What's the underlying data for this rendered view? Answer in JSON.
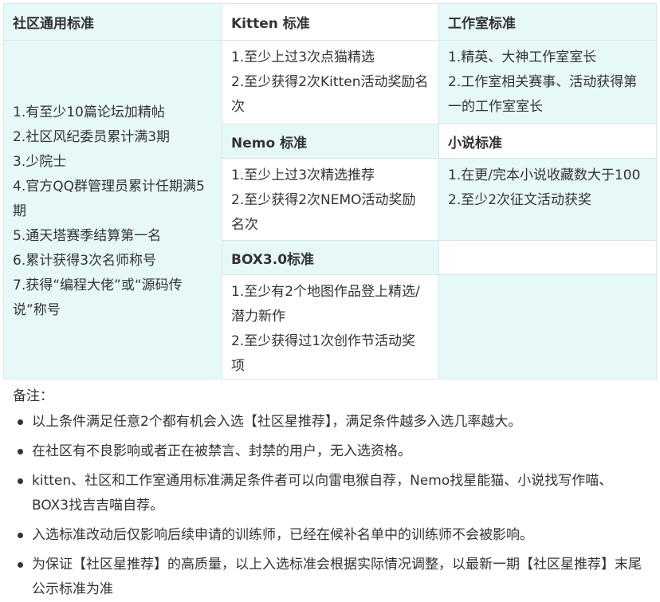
{
  "table": {
    "columns": [
      {
        "header": "社区通用标准",
        "items": [
          "1.有至少10篇论坛加精帖",
          "2.社区风纪委员累计满3期",
          "3.少院士",
          "4.官方QQ群管理员累计任期满5期",
          "5.通天塔赛季结算第一名",
          "6.累计获得3次名师称号",
          "7.获得“编程大佬”或“源码传说”称号"
        ]
      },
      {
        "sections": [
          {
            "header": "Kitten 标准",
            "items": [
              "1.至少上过3次点猫精选",
              "2.至少获得2次Kitten活动奖励名次"
            ]
          },
          {
            "header": "Nemo 标准",
            "items": [
              "1.至少上过3次精选推荐",
              "2.至少获得2次NEMO活动奖励名次"
            ]
          },
          {
            "header": "BOX3.0标准",
            "items": [
              "1.至少有2个地图作品登上精选/潜力新作",
              "2.至少获得过1次创作节活动奖项"
            ]
          }
        ]
      },
      {
        "sections": [
          {
            "header": "工作室标准",
            "items": [
              "1.精英、大神工作室室长",
              "2.工作室相关赛事、活动获得第一的工作室室长"
            ]
          },
          {
            "header": "小说标准",
            "items": [
              "1.在更/完本小说收藏数大于100",
              "2.至少2次征文活动获奖"
            ]
          }
        ]
      }
    ]
  },
  "notes": {
    "label": "备注：",
    "bullets": [
      "以上条件满足任意2个都有机会入选【社区星推荐】，满足条件越多入选几率越大。",
      "在社区有不良影响或者正在被禁言、封禁的用户，无入选资格。",
      "kitten、社区和工作室通用标准满足条件者可以向雷电猴自荐，Nemo找星能猫、小说找写作喵、BOX3找吉吉喵自荐。",
      "入选标准改动后仅影响后续申请的训练师，已经在候补名单中的训练师不会被影响。",
      "为保证【社区星推荐】的高质量，以上入选标准会根据实际情况调整，以最新一期【社区星推荐】末尾公示标准为准"
    ]
  }
}
